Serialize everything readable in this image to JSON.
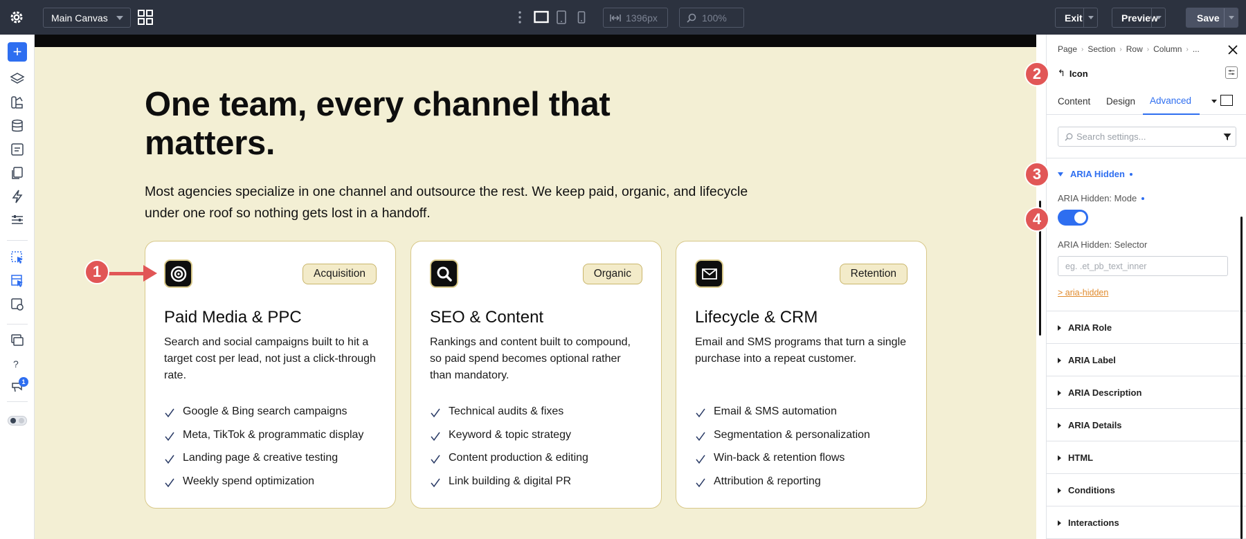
{
  "topbar": {
    "canvas_select": "Main Canvas",
    "width_value": "1396px",
    "zoom_value": "100%",
    "exit_label": "Exit",
    "preview_label": "Preview",
    "save_label": "Save",
    "icons": [
      "gear-icon",
      "grid-icon",
      "more-dots-icon",
      "desktop-icon",
      "tablet-icon",
      "phone-icon",
      "width-icon",
      "zoom-icon"
    ]
  },
  "sidebar": {
    "add_label": "+",
    "notification_count": "1"
  },
  "page": {
    "headline": "One team, every channel that matters.",
    "lede": "Most agencies specialize in one channel and outsource the rest. We keep paid, organic, and lifecycle under one roof so nothing gets lost in a handoff.",
    "cards": [
      {
        "icon": "target-icon",
        "tag": "Acquisition",
        "title": "Paid Media & PPC",
        "description": "Search and social campaigns built to hit a target cost per lead, not just a click-through rate.",
        "items": [
          "Google & Bing search campaigns",
          "Meta, TikTok & programmatic display",
          "Landing page & creative testing",
          "Weekly spend optimization"
        ]
      },
      {
        "icon": "search-icon",
        "tag": "Organic",
        "title": "SEO & Content",
        "description": "Rankings and content built to compound, so paid spend becomes optional rather than mandatory.",
        "items": [
          "Technical audits & fixes",
          "Keyword & topic strategy",
          "Content production & editing",
          "Link building & digital PR"
        ]
      },
      {
        "icon": "mail-icon",
        "tag": "Retention",
        "title": "Lifecycle & CRM",
        "description": "Email and SMS programs that turn a single purchase into a repeat customer.",
        "items": [
          "Email & SMS automation",
          "Segmentation & personalization",
          "Win-back & retention flows",
          "Attribution & reporting"
        ]
      }
    ]
  },
  "markers": [
    "1",
    "2",
    "3",
    "4"
  ],
  "panel": {
    "breadcrumb": [
      "Page",
      "Section",
      "Row",
      "Column",
      "..."
    ],
    "module_title": "Icon",
    "tabs": [
      "Content",
      "Design",
      "Advanced"
    ],
    "active_tab": "Advanced",
    "search_placeholder": "Search settings...",
    "open_group": "ARIA Hidden",
    "mode_label": "ARIA Hidden: Mode",
    "mode_on": true,
    "selector_label": "ARIA Hidden: Selector",
    "selector_placeholder": "eg. .et_pb_text_inner",
    "link_text": "> aria-hidden",
    "groups": [
      "ARIA Role",
      "ARIA Label",
      "ARIA Description",
      "ARIA Details",
      "HTML",
      "Conditions",
      "Interactions"
    ]
  },
  "colors": {
    "accent": "#2e6ef0",
    "marker": "#e15656",
    "canvas_bg": "#f3efd4",
    "topbar_bg": "#2c323f",
    "card_border": "#d8c889"
  }
}
